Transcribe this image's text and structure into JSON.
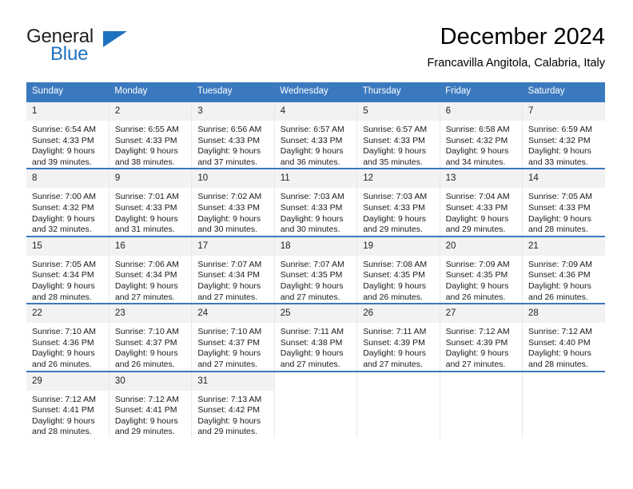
{
  "brand": {
    "name_part1": "General",
    "name_part2": "Blue",
    "triangle_color": "#1f72c0"
  },
  "header": {
    "title": "December 2024",
    "subtitle": "Francavilla Angitola, Calabria, Italy"
  },
  "calendar": {
    "header_bg": "#3b79bf",
    "daynum_bg": "#f2f2f2",
    "weekdays": [
      "Sunday",
      "Monday",
      "Tuesday",
      "Wednesday",
      "Thursday",
      "Friday",
      "Saturday"
    ],
    "weeks": [
      [
        {
          "day": "1",
          "sunrise": "Sunrise: 6:54 AM",
          "sunset": "Sunset: 4:33 PM",
          "daylight1": "Daylight: 9 hours",
          "daylight2": "and 39 minutes."
        },
        {
          "day": "2",
          "sunrise": "Sunrise: 6:55 AM",
          "sunset": "Sunset: 4:33 PM",
          "daylight1": "Daylight: 9 hours",
          "daylight2": "and 38 minutes."
        },
        {
          "day": "3",
          "sunrise": "Sunrise: 6:56 AM",
          "sunset": "Sunset: 4:33 PM",
          "daylight1": "Daylight: 9 hours",
          "daylight2": "and 37 minutes."
        },
        {
          "day": "4",
          "sunrise": "Sunrise: 6:57 AM",
          "sunset": "Sunset: 4:33 PM",
          "daylight1": "Daylight: 9 hours",
          "daylight2": "and 36 minutes."
        },
        {
          "day": "5",
          "sunrise": "Sunrise: 6:57 AM",
          "sunset": "Sunset: 4:33 PM",
          "daylight1": "Daylight: 9 hours",
          "daylight2": "and 35 minutes."
        },
        {
          "day": "6",
          "sunrise": "Sunrise: 6:58 AM",
          "sunset": "Sunset: 4:32 PM",
          "daylight1": "Daylight: 9 hours",
          "daylight2": "and 34 minutes."
        },
        {
          "day": "7",
          "sunrise": "Sunrise: 6:59 AM",
          "sunset": "Sunset: 4:32 PM",
          "daylight1": "Daylight: 9 hours",
          "daylight2": "and 33 minutes."
        }
      ],
      [
        {
          "day": "8",
          "sunrise": "Sunrise: 7:00 AM",
          "sunset": "Sunset: 4:32 PM",
          "daylight1": "Daylight: 9 hours",
          "daylight2": "and 32 minutes."
        },
        {
          "day": "9",
          "sunrise": "Sunrise: 7:01 AM",
          "sunset": "Sunset: 4:33 PM",
          "daylight1": "Daylight: 9 hours",
          "daylight2": "and 31 minutes."
        },
        {
          "day": "10",
          "sunrise": "Sunrise: 7:02 AM",
          "sunset": "Sunset: 4:33 PM",
          "daylight1": "Daylight: 9 hours",
          "daylight2": "and 30 minutes."
        },
        {
          "day": "11",
          "sunrise": "Sunrise: 7:03 AM",
          "sunset": "Sunset: 4:33 PM",
          "daylight1": "Daylight: 9 hours",
          "daylight2": "and 30 minutes."
        },
        {
          "day": "12",
          "sunrise": "Sunrise: 7:03 AM",
          "sunset": "Sunset: 4:33 PM",
          "daylight1": "Daylight: 9 hours",
          "daylight2": "and 29 minutes."
        },
        {
          "day": "13",
          "sunrise": "Sunrise: 7:04 AM",
          "sunset": "Sunset: 4:33 PM",
          "daylight1": "Daylight: 9 hours",
          "daylight2": "and 29 minutes."
        },
        {
          "day": "14",
          "sunrise": "Sunrise: 7:05 AM",
          "sunset": "Sunset: 4:33 PM",
          "daylight1": "Daylight: 9 hours",
          "daylight2": "and 28 minutes."
        }
      ],
      [
        {
          "day": "15",
          "sunrise": "Sunrise: 7:05 AM",
          "sunset": "Sunset: 4:34 PM",
          "daylight1": "Daylight: 9 hours",
          "daylight2": "and 28 minutes."
        },
        {
          "day": "16",
          "sunrise": "Sunrise: 7:06 AM",
          "sunset": "Sunset: 4:34 PM",
          "daylight1": "Daylight: 9 hours",
          "daylight2": "and 27 minutes."
        },
        {
          "day": "17",
          "sunrise": "Sunrise: 7:07 AM",
          "sunset": "Sunset: 4:34 PM",
          "daylight1": "Daylight: 9 hours",
          "daylight2": "and 27 minutes."
        },
        {
          "day": "18",
          "sunrise": "Sunrise: 7:07 AM",
          "sunset": "Sunset: 4:35 PM",
          "daylight1": "Daylight: 9 hours",
          "daylight2": "and 27 minutes."
        },
        {
          "day": "19",
          "sunrise": "Sunrise: 7:08 AM",
          "sunset": "Sunset: 4:35 PM",
          "daylight1": "Daylight: 9 hours",
          "daylight2": "and 26 minutes."
        },
        {
          "day": "20",
          "sunrise": "Sunrise: 7:09 AM",
          "sunset": "Sunset: 4:35 PM",
          "daylight1": "Daylight: 9 hours",
          "daylight2": "and 26 minutes."
        },
        {
          "day": "21",
          "sunrise": "Sunrise: 7:09 AM",
          "sunset": "Sunset: 4:36 PM",
          "daylight1": "Daylight: 9 hours",
          "daylight2": "and 26 minutes."
        }
      ],
      [
        {
          "day": "22",
          "sunrise": "Sunrise: 7:10 AM",
          "sunset": "Sunset: 4:36 PM",
          "daylight1": "Daylight: 9 hours",
          "daylight2": "and 26 minutes."
        },
        {
          "day": "23",
          "sunrise": "Sunrise: 7:10 AM",
          "sunset": "Sunset: 4:37 PM",
          "daylight1": "Daylight: 9 hours",
          "daylight2": "and 26 minutes."
        },
        {
          "day": "24",
          "sunrise": "Sunrise: 7:10 AM",
          "sunset": "Sunset: 4:37 PM",
          "daylight1": "Daylight: 9 hours",
          "daylight2": "and 27 minutes."
        },
        {
          "day": "25",
          "sunrise": "Sunrise: 7:11 AM",
          "sunset": "Sunset: 4:38 PM",
          "daylight1": "Daylight: 9 hours",
          "daylight2": "and 27 minutes."
        },
        {
          "day": "26",
          "sunrise": "Sunrise: 7:11 AM",
          "sunset": "Sunset: 4:39 PM",
          "daylight1": "Daylight: 9 hours",
          "daylight2": "and 27 minutes."
        },
        {
          "day": "27",
          "sunrise": "Sunrise: 7:12 AM",
          "sunset": "Sunset: 4:39 PM",
          "daylight1": "Daylight: 9 hours",
          "daylight2": "and 27 minutes."
        },
        {
          "day": "28",
          "sunrise": "Sunrise: 7:12 AM",
          "sunset": "Sunset: 4:40 PM",
          "daylight1": "Daylight: 9 hours",
          "daylight2": "and 28 minutes."
        }
      ],
      [
        {
          "day": "29",
          "sunrise": "Sunrise: 7:12 AM",
          "sunset": "Sunset: 4:41 PM",
          "daylight1": "Daylight: 9 hours",
          "daylight2": "and 28 minutes."
        },
        {
          "day": "30",
          "sunrise": "Sunrise: 7:12 AM",
          "sunset": "Sunset: 4:41 PM",
          "daylight1": "Daylight: 9 hours",
          "daylight2": "and 29 minutes."
        },
        {
          "day": "31",
          "sunrise": "Sunrise: 7:13 AM",
          "sunset": "Sunset: 4:42 PM",
          "daylight1": "Daylight: 9 hours",
          "daylight2": "and 29 minutes."
        },
        {
          "day": "",
          "sunrise": "",
          "sunset": "",
          "daylight1": "",
          "daylight2": ""
        },
        {
          "day": "",
          "sunrise": "",
          "sunset": "",
          "daylight1": "",
          "daylight2": ""
        },
        {
          "day": "",
          "sunrise": "",
          "sunset": "",
          "daylight1": "",
          "daylight2": ""
        },
        {
          "day": "",
          "sunrise": "",
          "sunset": "",
          "daylight1": "",
          "daylight2": ""
        }
      ]
    ]
  }
}
